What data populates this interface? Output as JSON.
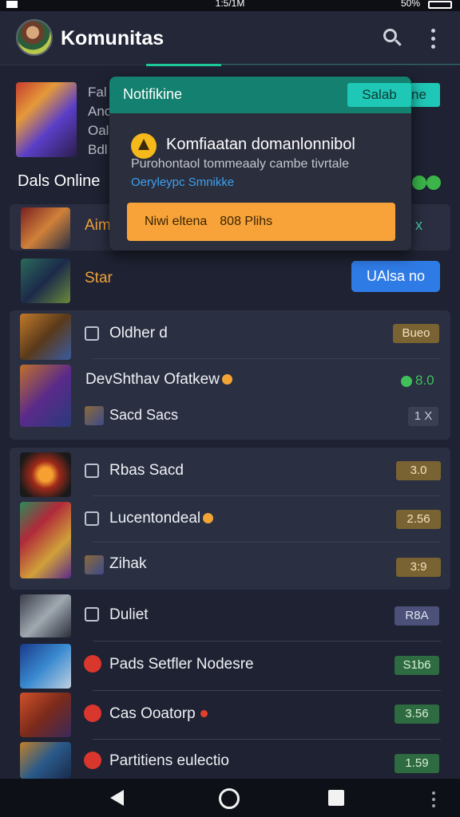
{
  "status": {
    "time": "1:5/1M",
    "battery": "50%"
  },
  "appbar": {
    "title": "Komunitas"
  },
  "featured": {
    "lines": [
      "Fal",
      "Anc",
      "Oal",
      "Bdl"
    ]
  },
  "section": {
    "title": "Dals Online"
  },
  "rows_top": [
    {
      "label": "Aim",
      "action": "x"
    },
    {
      "label": "Star",
      "button": "UAlsa no"
    }
  ],
  "card1": [
    {
      "label": "Oldher  d",
      "pill": "Bueo"
    },
    {
      "label": "DevShthav Ofatkew",
      "value": "8.0"
    },
    {
      "label": "Sacd Sacs",
      "pill": "1 X"
    }
  ],
  "card2": [
    {
      "label": "Rbas Sacd",
      "pill": "3.0"
    },
    {
      "label": "Lucentondeal",
      "pill": "2.56"
    },
    {
      "label": "Zihak",
      "pill": "3:9"
    }
  ],
  "rows_bottom": [
    {
      "label": "Duliet",
      "pill": "R8A"
    },
    {
      "label": "Pads Setfler Nodesre",
      "pill": "S1b6"
    },
    {
      "label": "Cas Ooatorp",
      "pill": "3.56"
    },
    {
      "label": "Partitiens  eulectio",
      "pill": "1.59"
    }
  ],
  "notification": {
    "title": "Notifikine",
    "tag": "Salab",
    "tag_ext": "ne",
    "heading": "Komfiaatan domanlonnibol",
    "desc": "Purohontaol tommeaaly cambe tivrtale",
    "link": "Oeryleypc Smnikke",
    "cta_a": "Niwi eltena",
    "cta_b": "808 Plihs"
  }
}
